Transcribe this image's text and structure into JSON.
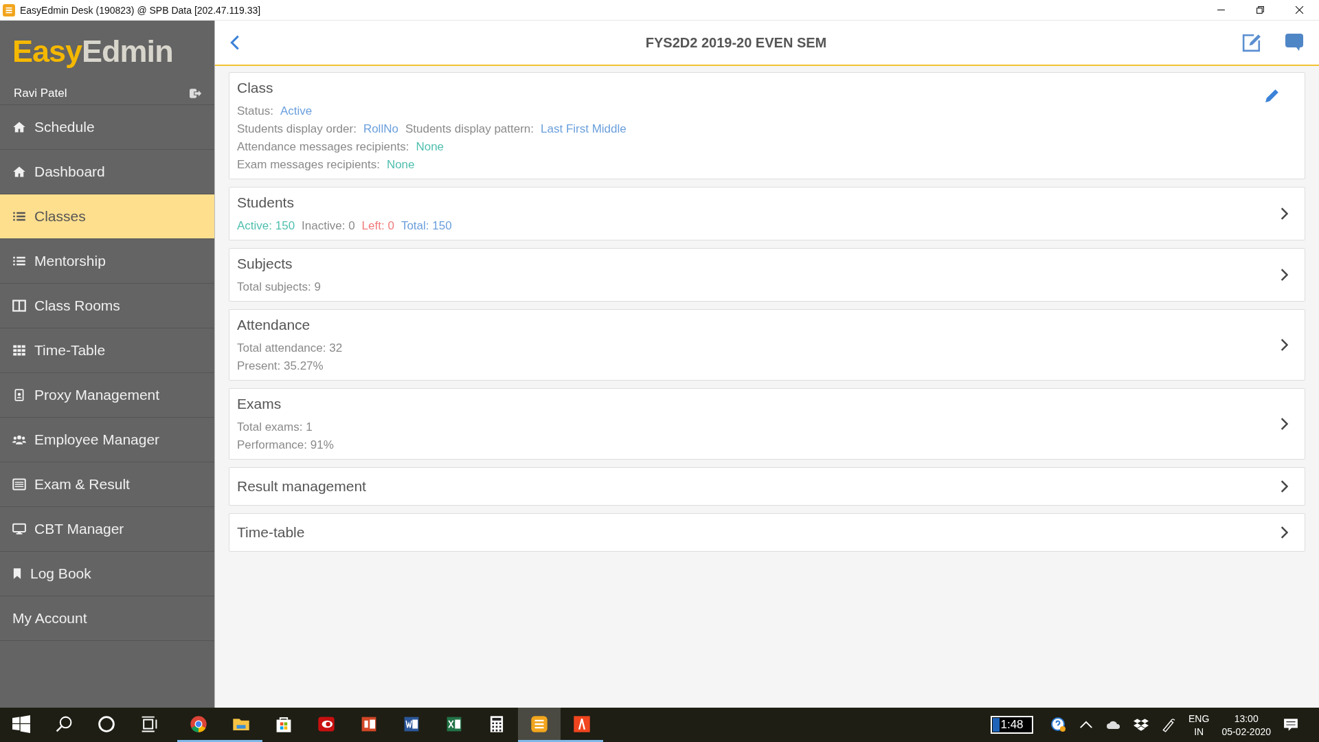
{
  "window": {
    "title": "EasyEdmin Desk (190823) @ SPB Data [202.47.119.33]"
  },
  "logo": {
    "part_1": "Easy",
    "part_2": "Edmin"
  },
  "user": {
    "name": "Ravi Patel"
  },
  "sidebar": {
    "items": [
      {
        "label": "Schedule",
        "kind": "home",
        "selected": false
      },
      {
        "label": "Dashboard",
        "kind": "home",
        "selected": false
      },
      {
        "label": "Classes",
        "kind": "list",
        "selected": true
      },
      {
        "label": "Mentorship",
        "kind": "list",
        "selected": false
      },
      {
        "label": "Class Rooms",
        "kind": "columns",
        "selected": false
      },
      {
        "label": "Time-Table",
        "kind": "grid",
        "selected": false
      },
      {
        "label": "Proxy Management",
        "kind": "badge",
        "selected": false
      },
      {
        "label": "Employee Manager",
        "kind": "users",
        "selected": false
      },
      {
        "label": "Exam & Result",
        "kind": "card",
        "selected": false
      },
      {
        "label": "CBT Manager",
        "kind": "monitor",
        "selected": false
      },
      {
        "label": "Log Book",
        "kind": "bookmark",
        "selected": false
      },
      {
        "label": "My Account",
        "kind": "plain",
        "selected": false
      }
    ]
  },
  "header": {
    "title": "FYS2D2 2019-20 EVEN SEM"
  },
  "cards": [
    {
      "title": "Class",
      "kind": "edit",
      "lines": [
        [
          {
            "text": "Status:",
            "color": "#8a8a8a"
          },
          {
            "text": "Active",
            "color": "#6a9fdc"
          }
        ],
        [
          {
            "text": "Students display order:",
            "color": "#8a8a8a"
          },
          {
            "text": "RollNo",
            "color": "#6a9fdc"
          },
          {
            "text": "Students display pattern:",
            "color": "#8a8a8a"
          },
          {
            "text": "Last First Middle",
            "color": "#6a9fdc"
          }
        ],
        [
          {
            "text": "Attendance messages recipients:",
            "color": "#8a8a8a"
          },
          {
            "text": "None",
            "color": "#4fbfae"
          }
        ],
        [
          {
            "text": "Exam messages recipients:",
            "color": "#8a8a8a"
          },
          {
            "text": "None",
            "color": "#4fbfae"
          }
        ]
      ]
    },
    {
      "title": "Students",
      "kind": "open",
      "lines": [
        [
          {
            "text": "Active: 150",
            "color": "#4fbfae"
          },
          {
            "text": "Inactive: 0",
            "color": "#8a8a8a"
          },
          {
            "text": "Left: 0",
            "color": "#f07a7a"
          },
          {
            "text": "Total: 150",
            "color": "#6a9fdc"
          }
        ]
      ]
    },
    {
      "title": "Subjects",
      "kind": "open",
      "lines": [
        [
          {
            "text": "Total subjects: 9",
            "color": "#8a8a8a"
          }
        ]
      ]
    },
    {
      "title": "Attendance",
      "kind": "open",
      "lines": [
        [
          {
            "text": "Total attendance: 32",
            "color": "#8a8a8a"
          }
        ],
        [
          {
            "text": "Present: 35.27%",
            "color": "#8a8a8a"
          }
        ]
      ]
    },
    {
      "title": "Exams",
      "kind": "open",
      "lines": [
        [
          {
            "text": "Total exams: 1",
            "color": "#8a8a8a"
          }
        ],
        [
          {
            "text": "Performance: 91%",
            "color": "#8a8a8a"
          }
        ]
      ]
    },
    {
      "title": "Result management",
      "kind": "open"
    },
    {
      "title": "Time-table",
      "kind": "open"
    }
  ],
  "taskbar": {
    "apps": [
      {
        "kind": "start",
        "running": false,
        "selected": false
      },
      {
        "kind": "search",
        "running": false,
        "selected": false
      },
      {
        "kind": "cortana",
        "running": false,
        "selected": false
      },
      {
        "kind": "taskview",
        "running": false,
        "selected": false
      },
      {
        "kind": "chrome",
        "running": true,
        "selected": false
      },
      {
        "kind": "explorer",
        "running": true,
        "selected": false
      },
      {
        "kind": "store",
        "running": false,
        "selected": false
      },
      {
        "kind": "reader",
        "running": false,
        "selected": false
      },
      {
        "kind": "powerpoint",
        "running": false,
        "selected": false
      },
      {
        "kind": "word",
        "running": false,
        "selected": false
      },
      {
        "kind": "excel",
        "running": false,
        "selected": false
      },
      {
        "kind": "calculator",
        "running": false,
        "selected": false
      },
      {
        "kind": "easyedmin",
        "running": true,
        "selected": true
      },
      {
        "kind": "pdf",
        "running": true,
        "selected": false
      }
    ],
    "battery_time": "1:48",
    "language": "ENG",
    "region": "IN",
    "time": "13:00",
    "date": "05-02-2020"
  }
}
